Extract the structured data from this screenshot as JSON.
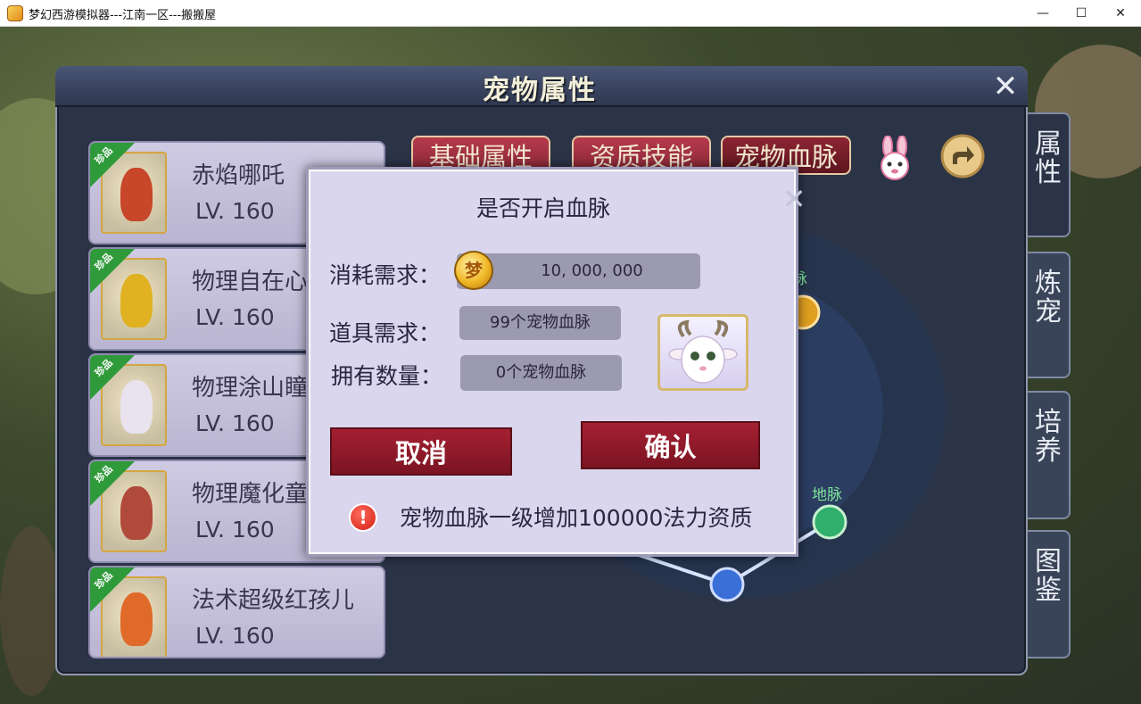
{
  "window": {
    "title": "梦幻西游模拟器---江南一区---搬搬屋",
    "minimize": "—",
    "maximize": "☐",
    "close": "✕"
  },
  "panel": {
    "title": "宠物属性",
    "close": "✕"
  },
  "pets": [
    {
      "name": "赤焰哪吒",
      "level": "LV. 160",
      "rarity": "珍品",
      "color": "#c8462a"
    },
    {
      "name": "物理自在心",
      "level": "LV. 160",
      "rarity": "珍品",
      "color": "#e0b222"
    },
    {
      "name": "物理涂山瞳",
      "level": "LV. 160",
      "rarity": "珍品",
      "color": "#e8e3ee"
    },
    {
      "name": "物理魔化童",
      "level": "LV. 160",
      "rarity": "珍品",
      "color": "#b04a3a"
    },
    {
      "name": "法术超级红孩儿",
      "level": "LV. 160",
      "rarity": "珍品",
      "color": "#e06a2a"
    }
  ],
  "tabs": [
    {
      "label": "基础属性",
      "active": false
    },
    {
      "label": "资质技能",
      "active": false
    },
    {
      "label": "宠物血脉",
      "active": true
    }
  ],
  "side_tabs": [
    "属性",
    "炼宠",
    "培养",
    "图鉴"
  ],
  "network": {
    "nodes": [
      "脉",
      "地脉"
    ]
  },
  "modal": {
    "title": "是否开启血脉",
    "close": "✕",
    "cost_label": "消耗需求：",
    "cost_value": "10, 000, 000",
    "coin_glyph": "梦",
    "item_label": "道具需求：",
    "item_value": "99个宠物血脉",
    "owned_label": "拥有数量：",
    "owned_value": "0个宠物血脉",
    "cancel": "取消",
    "confirm": "确认",
    "warn_glyph": "!",
    "hint": "宠物血脉一级增加100000法力资质"
  },
  "colors": {
    "accent": "#8c2532",
    "rarity": "#2f9a3a"
  }
}
